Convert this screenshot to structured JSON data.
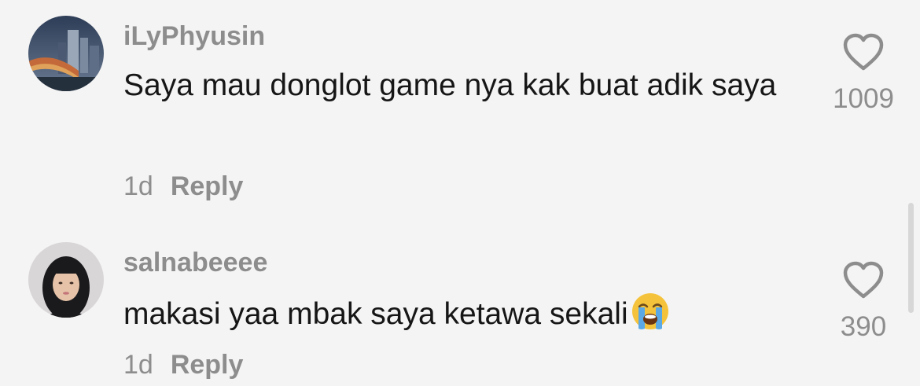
{
  "comments": [
    {
      "username": "iLyPhyusin",
      "text": "Saya mau donglot game nya kak buat adik saya",
      "time": "1d",
      "reply_label": "Reply",
      "likes": "1009"
    },
    {
      "username": "salnabeeee",
      "text": "makasi yaa mbak saya ketawa sekali",
      "time": "1d",
      "reply_label": "Reply",
      "likes": "390",
      "emoji": "loudly-crying-face"
    }
  ],
  "colors": {
    "background": "#f4f4f4",
    "text_primary": "#161616",
    "text_secondary": "#8d8d8d"
  }
}
